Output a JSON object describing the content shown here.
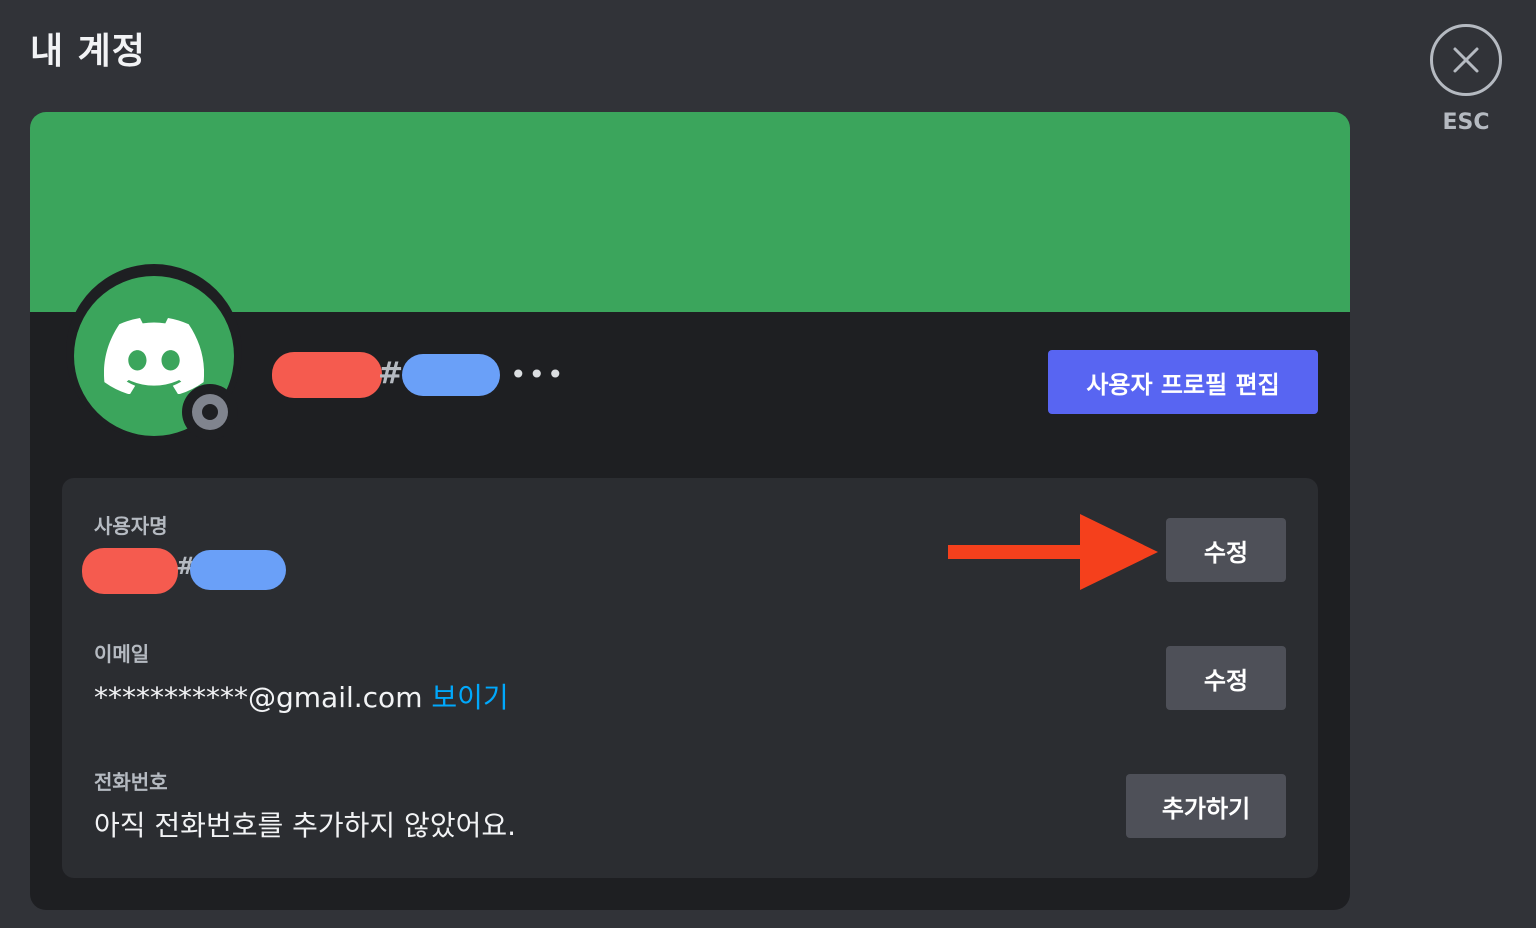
{
  "header": {
    "title": "내 계정",
    "close_label": "ESC"
  },
  "profile": {
    "banner_color": "#3ba55c",
    "avatar_icon": "discord-logo-icon",
    "status": "offline",
    "username_separator": "#",
    "more_label": "•••",
    "edit_profile_label": "사용자 프로필 편집"
  },
  "fields": {
    "username": {
      "label": "사용자명",
      "separator": "#",
      "button_label": "수정"
    },
    "email": {
      "label": "이메일",
      "value": "***********@gmail.com",
      "reveal_label": "보이기",
      "button_label": "수정"
    },
    "phone": {
      "label": "전화번호",
      "value": "아직 전화번호를 추가하지 않았어요.",
      "button_label": "추가하기"
    }
  },
  "colors": {
    "accent": "#5865f2",
    "link": "#00a8fc",
    "annotation_arrow": "#f5401c",
    "redaction_red": "#f55b4f",
    "redaction_blue": "#6aa0f8"
  }
}
